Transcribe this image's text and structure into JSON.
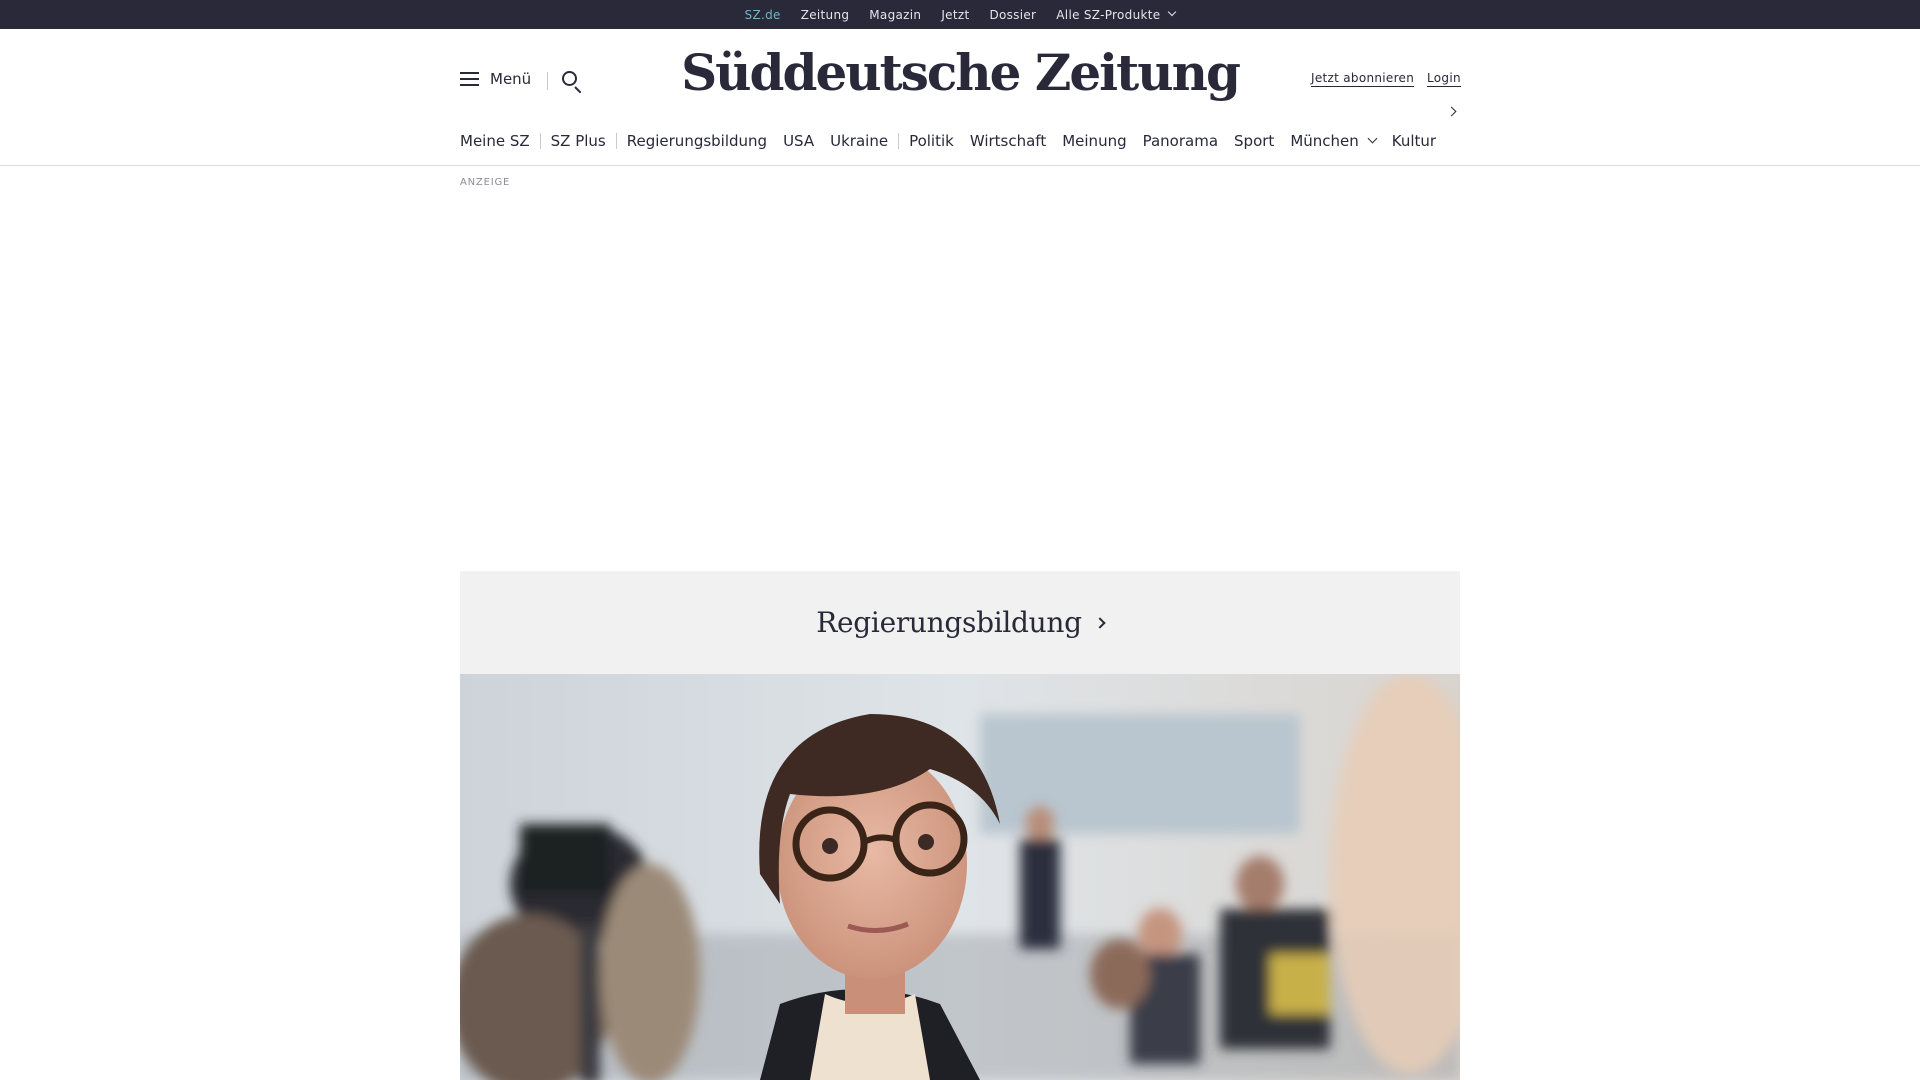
{
  "topbar": {
    "links": [
      "SZ.de",
      "Zeitung",
      "Magazin",
      "Jetzt",
      "Dossier",
      "Alle SZ-Produkte"
    ]
  },
  "header": {
    "menu_label": "Menü",
    "logo_text": "Süddeutsche Zeitung",
    "subscribe_label": "Jetzt abonnieren",
    "login_label": "Login"
  },
  "section_nav": {
    "items": [
      "Meine SZ",
      "SZ Plus",
      "Regierungsbildung",
      "USA",
      "Ukraine",
      "Politik",
      "Wirtschaft",
      "Meinung",
      "Panorama",
      "Sport",
      "München",
      "Kultur"
    ]
  },
  "ad": {
    "label": "ANZEIGE"
  },
  "teaser": {
    "title": "Regierungsbildung"
  },
  "colors": {
    "dark": "#29293a",
    "active_link": "#71b6c4",
    "teaser_bg": "#f1f1f1"
  },
  "icons": [
    "hamburger-icon",
    "search-icon",
    "chevron-down-icon",
    "chevron-right-icon"
  ]
}
